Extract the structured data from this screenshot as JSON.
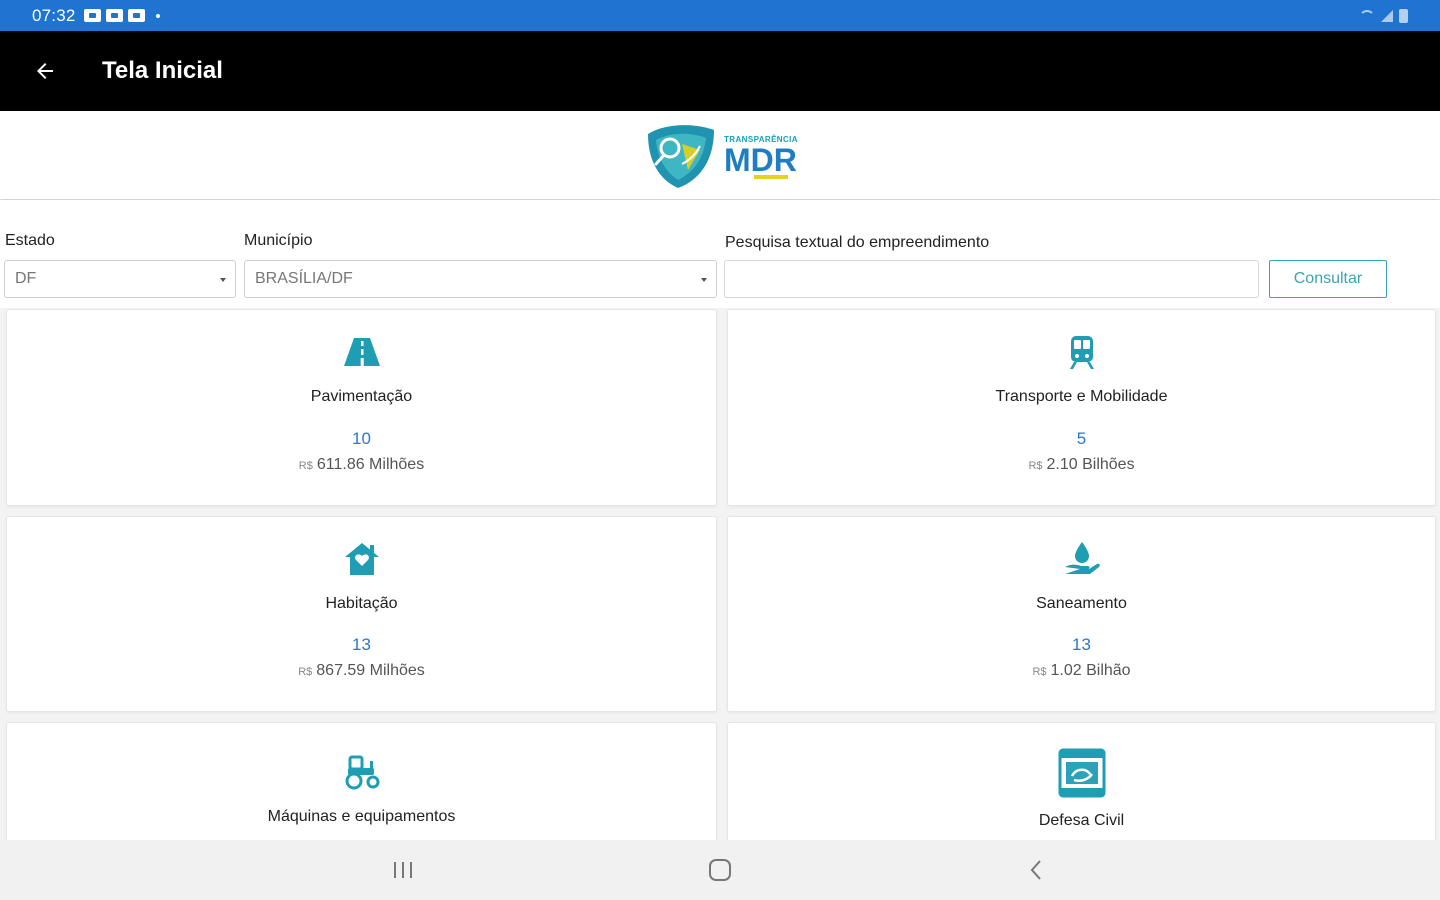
{
  "status_bar": {
    "time": "07:32"
  },
  "app_bar": {
    "title": "Tela Inicial"
  },
  "logo": {
    "small_text": "TRANSPARÊNCIA",
    "big_text": "MDR"
  },
  "filters": {
    "estado_label": "Estado",
    "estado_value": "DF",
    "municipio_label": "Município",
    "municipio_value": "BRASÍLIA/DF",
    "search_label": "Pesquisa textual do empreendimento",
    "search_value": "",
    "consult_label": "Consultar"
  },
  "cards": [
    {
      "name": "Pavimentação",
      "count": "10",
      "currency": "R$",
      "value": "611.86 Milhões",
      "icon": "road-icon"
    },
    {
      "name": "Transporte e Mobilidade",
      "count": "5",
      "currency": "R$",
      "value": "2.10 Bilhões",
      "icon": "train-icon"
    },
    {
      "name": "Habitação",
      "count": "13",
      "currency": "R$",
      "value": "867.59 Milhões",
      "icon": "house-icon"
    },
    {
      "name": "Saneamento",
      "count": "13",
      "currency": "R$",
      "value": "1.02 Bilhão",
      "icon": "water-hand-icon"
    },
    {
      "name": "Máquinas e equipamentos",
      "icon": "tractor-icon"
    },
    {
      "name": "Defesa Civil",
      "icon": "civil-defense-icon"
    }
  ],
  "colors": {
    "status_bar": "#1f73d1",
    "app_bar": "#000000",
    "accent": "#1f9db3",
    "count": "#2b78c5"
  }
}
